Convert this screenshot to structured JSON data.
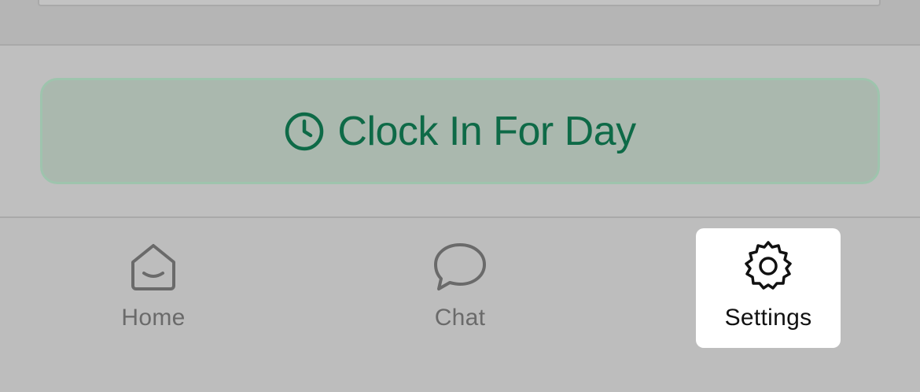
{
  "action": {
    "clock_in_label": "Clock In For Day",
    "clock_icon": "clock-icon",
    "accent_color": "#0e6a47"
  },
  "tabs": [
    {
      "label": "Home",
      "icon": "home-icon",
      "selected": false
    },
    {
      "label": "Chat",
      "icon": "chat-bubble-icon",
      "selected": false
    },
    {
      "label": "Settings",
      "icon": "gear-icon",
      "selected": true
    }
  ]
}
